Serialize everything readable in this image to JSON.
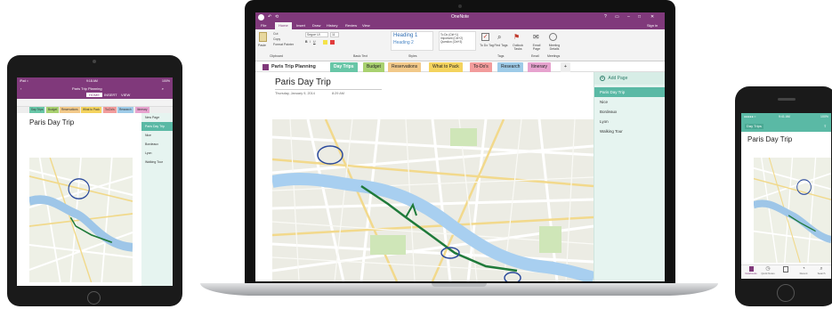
{
  "app": {
    "title": "OneNote",
    "window_controls": [
      "?",
      "▭",
      "–",
      "□",
      "✕"
    ],
    "signin": "Sign in",
    "quick_access": [
      "↶",
      "⟲"
    ],
    "ribbon_tabs": [
      "File",
      "Home",
      "Insert",
      "Draw",
      "History",
      "Review",
      "View"
    ],
    "active_tab": "Home",
    "clipboard": {
      "paste": "Paste",
      "cut": "Cut",
      "copy": "Copy",
      "format_painter": "Format Painter",
      "group": "Clipboard"
    },
    "basic_text": {
      "font": "Segoe UI",
      "size": "11",
      "group": "Basic Text"
    },
    "styles": {
      "heading1": "Heading 1",
      "heading2": "Heading 2",
      "group": "Styles"
    },
    "tags": {
      "items": [
        "To Do (Ctrl+1)",
        "Important (Ctrl+2)",
        "Question (Ctrl+3)"
      ],
      "todo_tag": "To Do Tag",
      "find_tags": "Find Tags",
      "outlook_tasks": "Outlook Tasks",
      "group": "Tags"
    },
    "email": {
      "label": "Email Page",
      "group": "Email"
    },
    "meetings": {
      "label": "Meeting Details",
      "group": "Meetings"
    },
    "notebook": "Paris Trip Planning",
    "sections": [
      {
        "label": "Day Trips",
        "color": "#68c6a7"
      },
      {
        "label": "Budget",
        "color": "#a9d170"
      },
      {
        "label": "Reservations",
        "color": "#f2c98a"
      },
      {
        "label": "What to Pack",
        "color": "#f4d35e"
      },
      {
        "label": "To-Do's",
        "color": "#f29c9c"
      },
      {
        "label": "Research",
        "color": "#9ecbe8"
      },
      {
        "label": "Itinerary",
        "color": "#e7a3cf"
      }
    ],
    "add_section": "+",
    "page_title": "Paris Day Trip",
    "page_date": "Thursday, January 9, 2014",
    "page_time": "8:29 AM",
    "add_page": "Add Page",
    "pages": [
      "Paris Day Trip",
      "Nice",
      "Bordeaux",
      "Lyon",
      "Walking Tour"
    ],
    "selected_page": "Paris Day Trip"
  },
  "ipad": {
    "status_left": "iPad ≈",
    "status_time": "9:18 AM",
    "status_right": "100%",
    "notebook": "Paris Trip Planning",
    "ribbon_tabs": [
      "HOME",
      "INSERT",
      "VIEW"
    ],
    "sections": [
      "Day Trips",
      "Budget",
      "Reservations",
      "What to Pack",
      "To-Do's",
      "Research",
      "Itinerary"
    ],
    "page_title": "Paris Day Trip",
    "new_page": "New Page",
    "pages": [
      "Paris Day Trip",
      "Nice",
      "Bordeaux",
      "Lyon",
      "Walking Tour"
    ]
  },
  "iphone": {
    "status_left": "●●●●● ≈",
    "status_time": "9:41 AM",
    "status_right": "100%",
    "back": "Day Trips",
    "page_title": "Paris Day Trip",
    "tab_labels": [
      "Notebooks",
      "Quick Notes",
      "",
      "Recent",
      "Search"
    ]
  },
  "colors": {
    "onenote_purple": "#80397b",
    "ribbon": "#f3f3f3",
    "teal": "#5ab9a5",
    "page_list_bg": "#e6f4f0",
    "route": "#1f7a3a"
  }
}
